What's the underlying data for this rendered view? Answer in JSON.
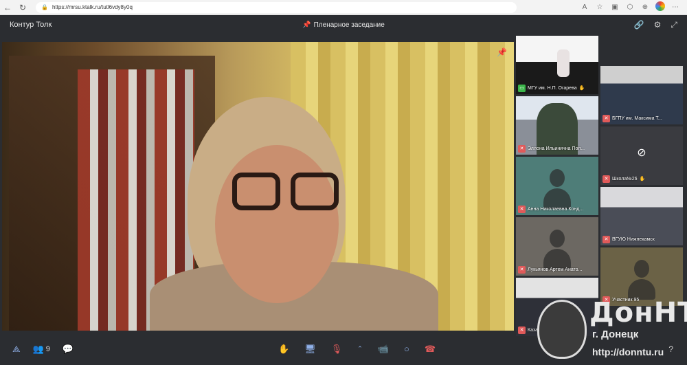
{
  "browser": {
    "url": "https://mrsu.ktalk.ru/tutl6vdy8y0q"
  },
  "app": {
    "title": "Контур Толк",
    "conference_title": "Пленарное заседание"
  },
  "participants": [
    {
      "name": "МГУ им. Н.П. Огарева",
      "status": "camera-on",
      "active": true
    },
    {
      "name": "БГПУ им. Максима Т...",
      "status": "mic-off"
    },
    {
      "name": "Эллона Ильинична Пол...",
      "status": "mic-off"
    },
    {
      "name": "Школа№26",
      "status": "mic-off",
      "camera": "off"
    },
    {
      "name": "Анна Николаевна Конд...",
      "status": "mic-off"
    },
    {
      "name": "ВГУЮ Нижнекамск",
      "status": "mic-off"
    },
    {
      "name": "Лукьянов Артем Анато...",
      "status": "mic-off"
    },
    {
      "name": "Участник 95",
      "status": "mic-off"
    },
    {
      "name": "Казанский институт",
      "status": "mic-off"
    }
  ],
  "toolbar": {
    "participants_count": "9"
  },
  "watermark": {
    "name": "ДонНТУ",
    "city": "г. Донецк",
    "url": "http://donntu.ru"
  },
  "colors": {
    "app_bg": "#2b2d31",
    "accent": "#3b8cff",
    "mic_off": "#e05a5a",
    "camera_on": "#3bb54a"
  }
}
